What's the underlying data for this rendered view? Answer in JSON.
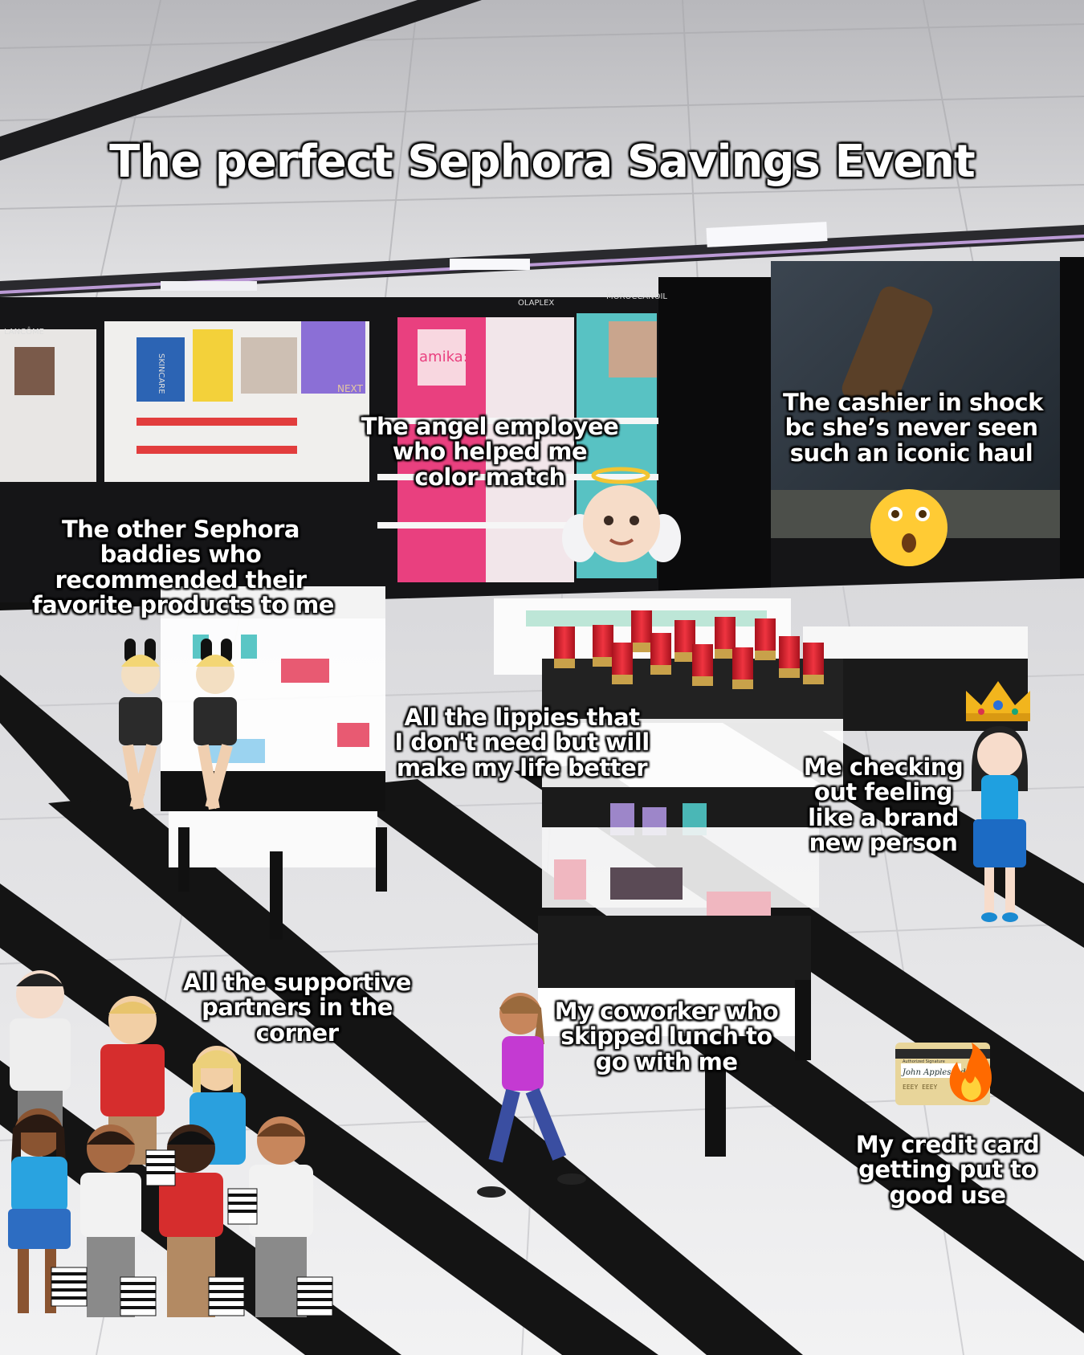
{
  "title": "The perfect Sephora Savings Event",
  "captions": {
    "angel": [
      "The angel employee",
      "who helped me",
      "color match"
    ],
    "cashier": [
      "The cashier in shock",
      "bc she’s never seen",
      "such an iconic haul"
    ],
    "baddies": [
      "The other Sephora",
      "baddies who",
      "recommended their",
      "favorite products to me"
    ],
    "lippies": [
      "All the lippies that",
      "I don't need but will",
      "make my life better"
    ],
    "me": [
      "Me checking",
      "out feeling",
      "like a brand",
      "new person"
    ],
    "partners": [
      "All the supportive",
      "partners in the",
      "corner"
    ],
    "coworker": [
      "My coworker who",
      "skipped lunch to",
      "go with me"
    ],
    "credit": [
      "My credit card",
      "getting put to",
      "good use"
    ]
  },
  "store_signs": {
    "lancome": "LANCÔME",
    "skincare": "SKINCARE",
    "amika": "amika:",
    "olaplex": "OLAPLEX",
    "moroccan": "MOROCCANOIL",
    "next": "NEXT"
  },
  "card": {
    "signature_label": "Authorized Signature",
    "signature": "John Appleseed",
    "number_fragment": "EEEY EEEY"
  },
  "emoji": {
    "angel": "baby-angel-emoji",
    "shock": "astonished-face-emoji",
    "crown": "crown-emoji",
    "fire": "fire-emoji",
    "bunny": "people-with-bunny-ears-emoji",
    "coworker": "woman-walking-emoji",
    "partners": "group-with-shopping-bags-emoji"
  },
  "colors": {
    "floor_light": "#e8e8ea",
    "floor_stripe": "#141414",
    "lipstick": "#d81f2e",
    "ceiling": "#cfcfd2"
  }
}
